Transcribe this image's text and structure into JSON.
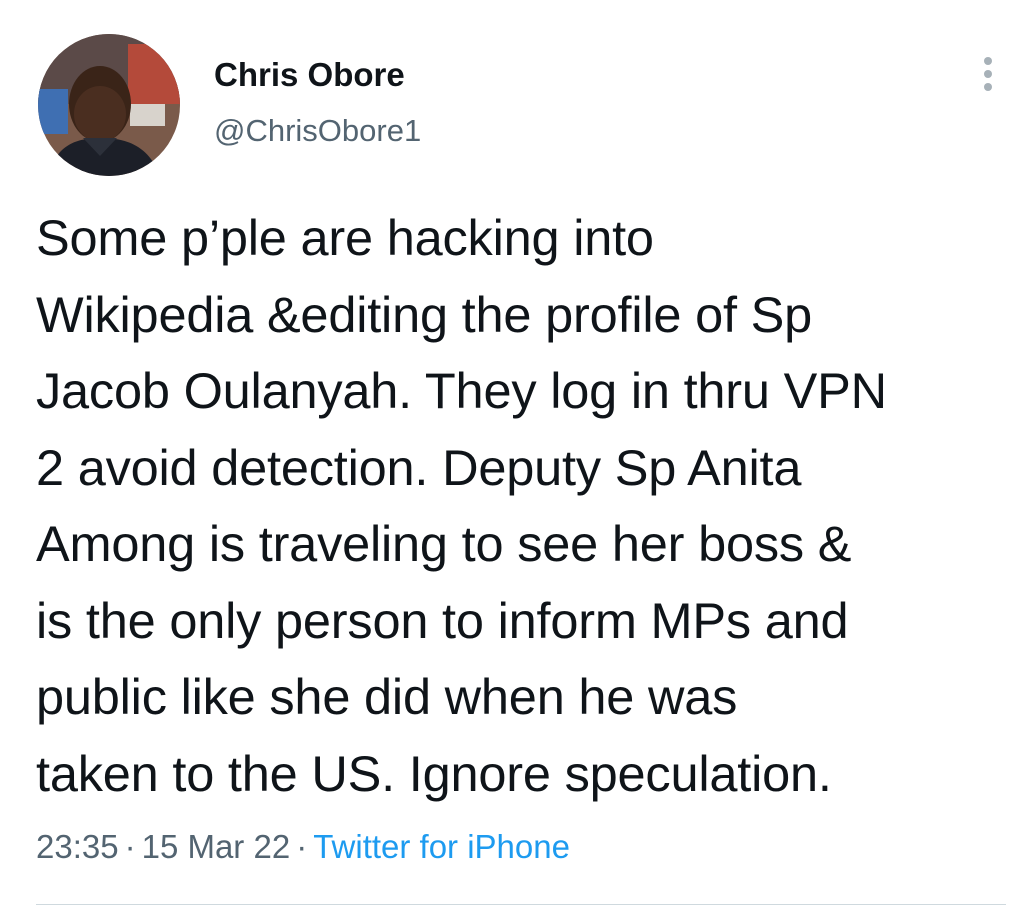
{
  "author": {
    "display_name": "Chris Obore",
    "handle": "@ChrisObore1",
    "avatar_icon": "profile-photo"
  },
  "tweet": {
    "text": "Some p’ple are hacking into\nWikipedia &editing the profile of Sp\nJacob Oulanyah. They log in thru VPN\n2 avoid detection. Deputy Sp Anita\nAmong is traveling to see her boss &\nis the only person to inform MPs and\npublic like she did when he was\ntaken to the US. Ignore speculation.",
    "time": "23:35",
    "separator": "·",
    "date": "15 Mar 22",
    "source": "Twitter for iPhone"
  },
  "icons": {
    "more": "more-vertical-icon"
  },
  "colors": {
    "text": "#0f1419",
    "secondary": "#536471",
    "link": "#1d9bf0",
    "divider": "#cfd9de"
  }
}
